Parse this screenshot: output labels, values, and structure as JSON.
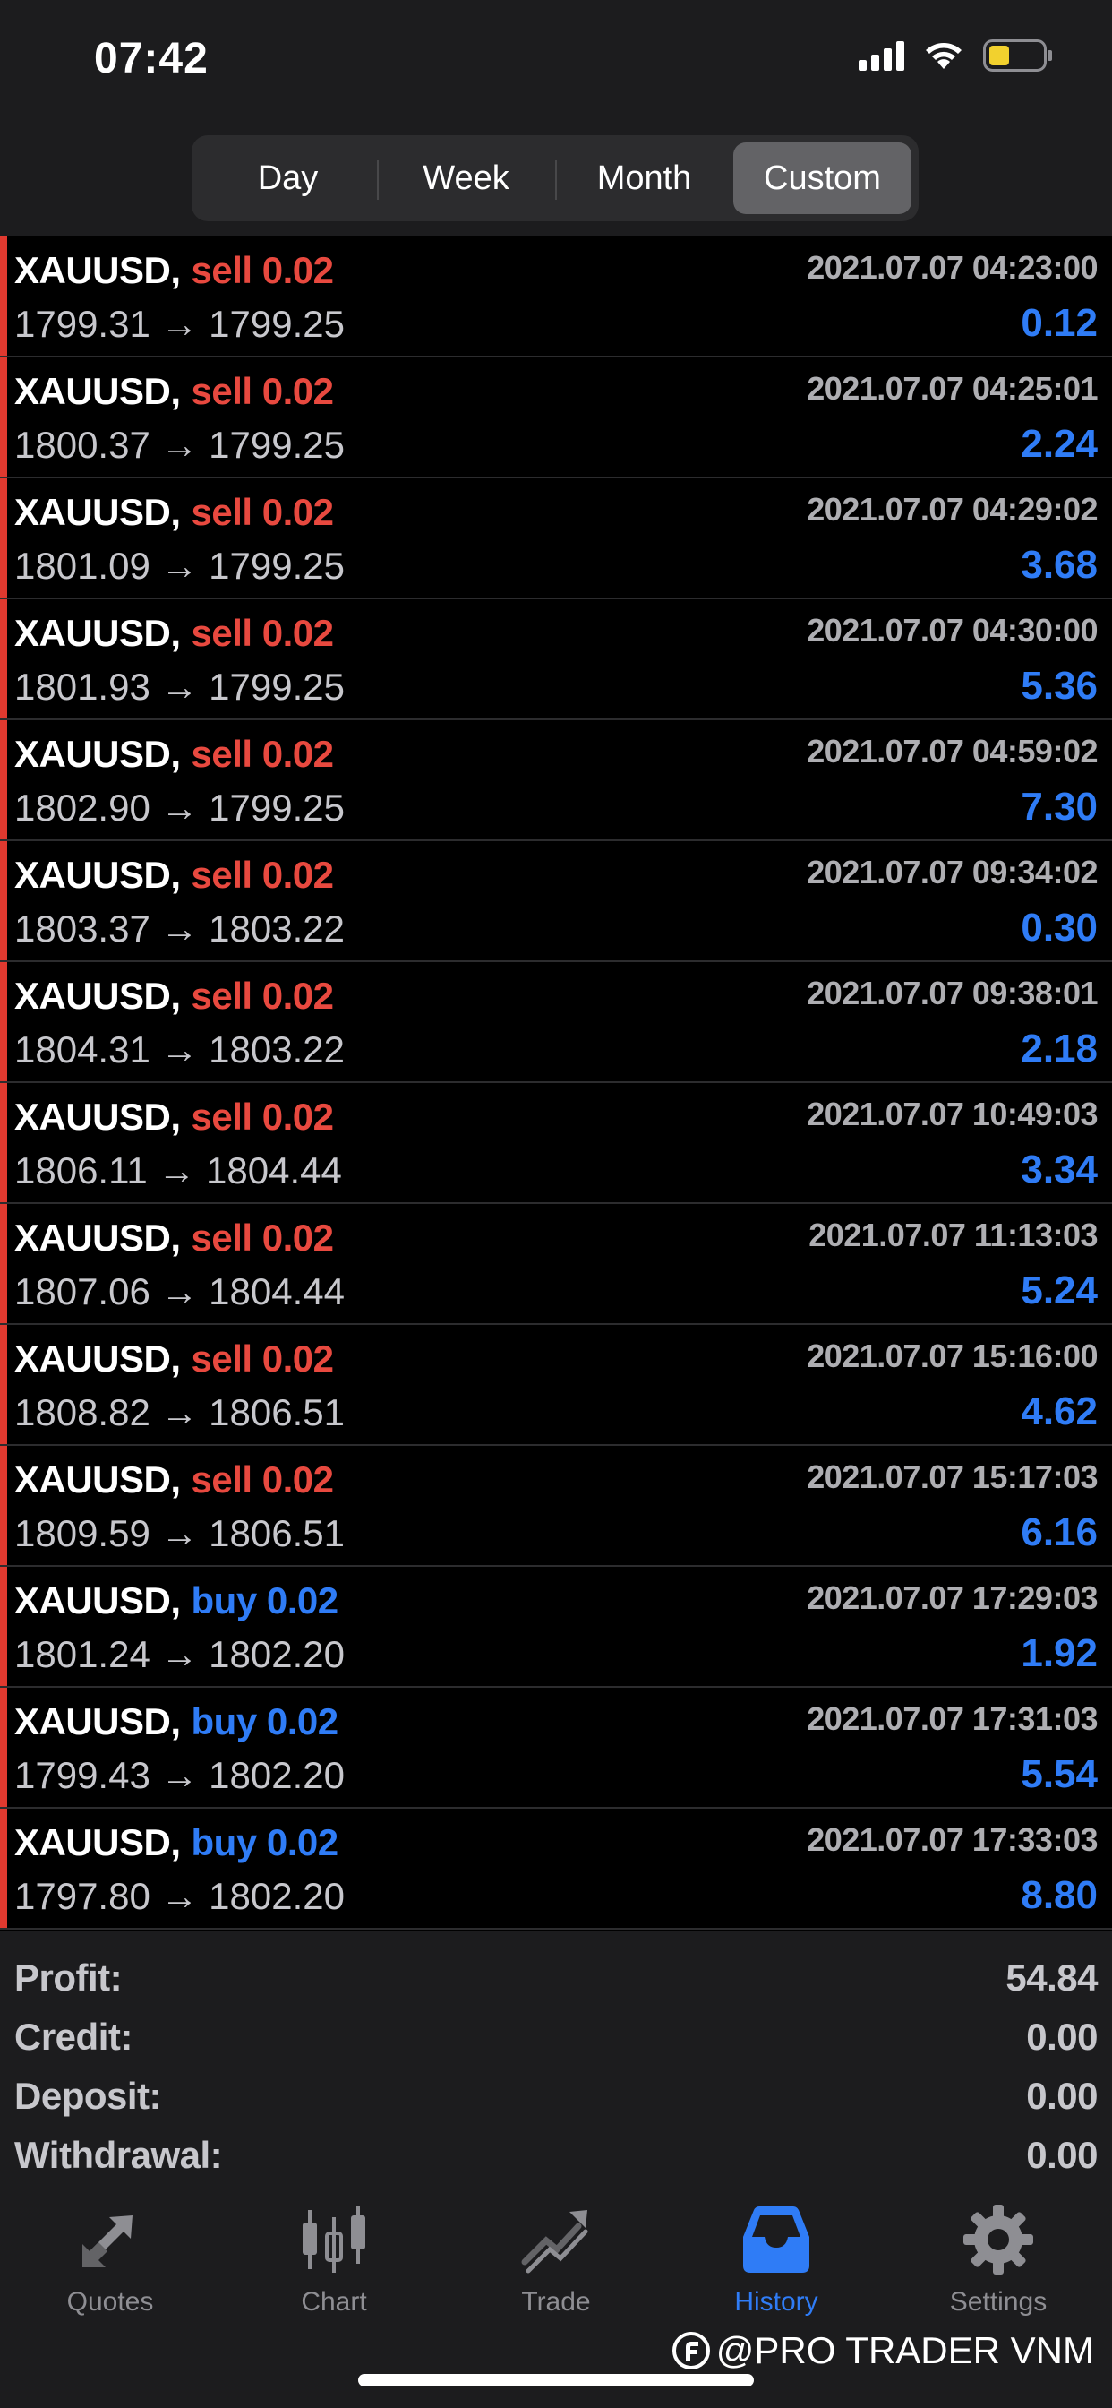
{
  "status_bar": {
    "time": "07:42"
  },
  "segments": [
    {
      "label": "Day",
      "active": false
    },
    {
      "label": "Week",
      "active": false
    },
    {
      "label": "Month",
      "active": false
    },
    {
      "label": "Custom",
      "active": true
    }
  ],
  "arrow": "→",
  "trades": [
    {
      "symbol": "XAUUSD,",
      "side": "sell",
      "volume": "0.02",
      "open": "1799.31",
      "close": "1799.25",
      "time": "2021.07.07 04:23:00",
      "profit": "0.12"
    },
    {
      "symbol": "XAUUSD,",
      "side": "sell",
      "volume": "0.02",
      "open": "1800.37",
      "close": "1799.25",
      "time": "2021.07.07 04:25:01",
      "profit": "2.24"
    },
    {
      "symbol": "XAUUSD,",
      "side": "sell",
      "volume": "0.02",
      "open": "1801.09",
      "close": "1799.25",
      "time": "2021.07.07 04:29:02",
      "profit": "3.68"
    },
    {
      "symbol": "XAUUSD,",
      "side": "sell",
      "volume": "0.02",
      "open": "1801.93",
      "close": "1799.25",
      "time": "2021.07.07 04:30:00",
      "profit": "5.36"
    },
    {
      "symbol": "XAUUSD,",
      "side": "sell",
      "volume": "0.02",
      "open": "1802.90",
      "close": "1799.25",
      "time": "2021.07.07 04:59:02",
      "profit": "7.30"
    },
    {
      "symbol": "XAUUSD,",
      "side": "sell",
      "volume": "0.02",
      "open": "1803.37",
      "close": "1803.22",
      "time": "2021.07.07 09:34:02",
      "profit": "0.30"
    },
    {
      "symbol": "XAUUSD,",
      "side": "sell",
      "volume": "0.02",
      "open": "1804.31",
      "close": "1803.22",
      "time": "2021.07.07 09:38:01",
      "profit": "2.18"
    },
    {
      "symbol": "XAUUSD,",
      "side": "sell",
      "volume": "0.02",
      "open": "1806.11",
      "close": "1804.44",
      "time": "2021.07.07 10:49:03",
      "profit": "3.34"
    },
    {
      "symbol": "XAUUSD,",
      "side": "sell",
      "volume": "0.02",
      "open": "1807.06",
      "close": "1804.44",
      "time": "2021.07.07 11:13:03",
      "profit": "5.24"
    },
    {
      "symbol": "XAUUSD,",
      "side": "sell",
      "volume": "0.02",
      "open": "1808.82",
      "close": "1806.51",
      "time": "2021.07.07 15:16:00",
      "profit": "4.62"
    },
    {
      "symbol": "XAUUSD,",
      "side": "sell",
      "volume": "0.02",
      "open": "1809.59",
      "close": "1806.51",
      "time": "2021.07.07 15:17:03",
      "profit": "6.16"
    },
    {
      "symbol": "XAUUSD,",
      "side": "buy",
      "volume": "0.02",
      "open": "1801.24",
      "close": "1802.20",
      "time": "2021.07.07 17:29:03",
      "profit": "1.92"
    },
    {
      "symbol": "XAUUSD,",
      "side": "buy",
      "volume": "0.02",
      "open": "1799.43",
      "close": "1802.20",
      "time": "2021.07.07 17:31:03",
      "profit": "5.54"
    },
    {
      "symbol": "XAUUSD,",
      "side": "buy",
      "volume": "0.02",
      "open": "1797.80",
      "close": "1802.20",
      "time": "2021.07.07 17:33:03",
      "profit": "8.80"
    }
  ],
  "summary": {
    "profit_label": "Profit:",
    "profit_value": "54.84",
    "credit_label": "Credit:",
    "credit_value": "0.00",
    "deposit_label": "Deposit:",
    "deposit_value": "0.00",
    "withdrawal_label": "Withdrawal:",
    "withdrawal_value": "0.00"
  },
  "tabs": [
    {
      "label": "Quotes",
      "icon": "quotes-arrows-icon",
      "active": false
    },
    {
      "label": "Chart",
      "icon": "candlestick-icon",
      "active": false
    },
    {
      "label": "Trade",
      "icon": "trade-trend-icon",
      "active": false
    },
    {
      "label": "History",
      "icon": "inbox-tray-icon",
      "active": true
    },
    {
      "label": "Settings",
      "icon": "gear-icon",
      "active": false
    }
  ],
  "watermark": "@PRO TRADER VNM",
  "colors": {
    "sell": "#e8493f",
    "buy": "#2f7cf6",
    "profit": "#2f7cf6",
    "accent": "#2f7cf6",
    "stripe": "#e0392f"
  }
}
